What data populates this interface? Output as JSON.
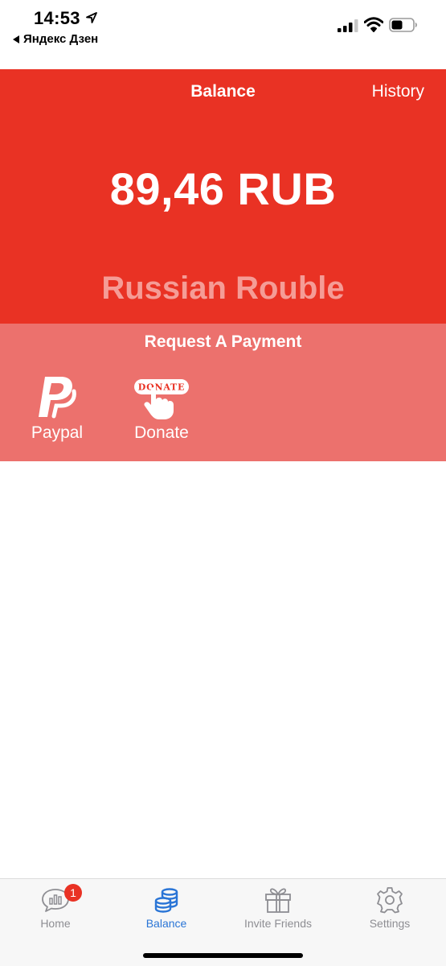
{
  "status_bar": {
    "time": "14:53",
    "back_app": "Яндекс Дзен",
    "icons": [
      "location-arrow-icon",
      "cellular-signal-icon",
      "wifi-icon",
      "battery-icon"
    ]
  },
  "header": {
    "title": "Balance",
    "history_label": "History"
  },
  "balance": {
    "amount": "89,46 RUB",
    "currency_name": "Russian Rouble"
  },
  "request_payment": {
    "title": "Request A Payment",
    "options": [
      {
        "label": "Paypal",
        "icon": "paypal-icon"
      },
      {
        "label": "Donate",
        "icon": "donate-hand-icon",
        "badge_text": "DONATE"
      }
    ]
  },
  "tab_bar": {
    "tabs": [
      {
        "label": "Home",
        "icon": "home-chat-chart-icon",
        "badge": "1"
      },
      {
        "label": "Balance",
        "icon": "coins-icon",
        "active": true
      },
      {
        "label": "Invite Friends",
        "icon": "gift-icon"
      },
      {
        "label": "Settings",
        "icon": "gear-icon"
      }
    ]
  },
  "colors": {
    "primary_red": "#e93224",
    "request_panel": "#ec716d",
    "currency_text": "#f59c96",
    "active_tab": "#2a75d6",
    "inactive_tab": "#8e8e93"
  }
}
